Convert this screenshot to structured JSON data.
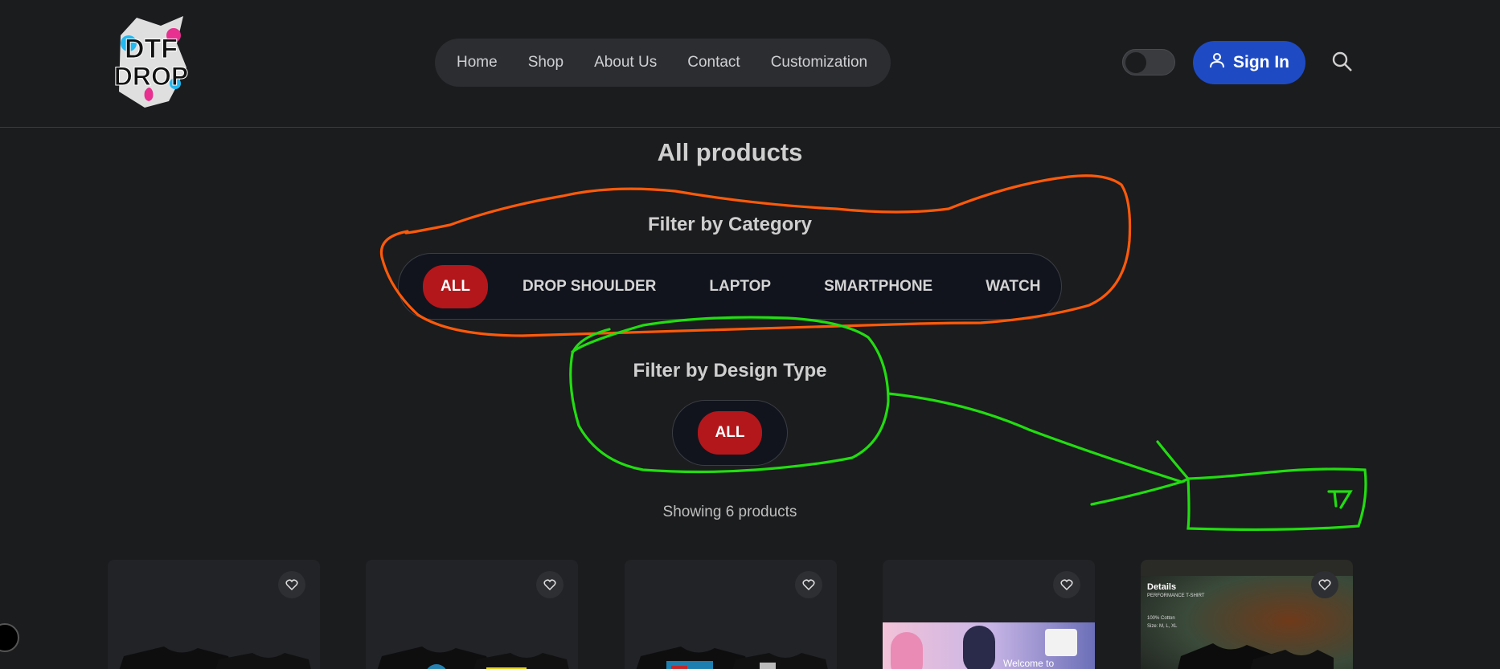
{
  "brand": {
    "logo_line1": "DTF",
    "logo_line2": "DROP"
  },
  "nav": {
    "items": [
      "Home",
      "Shop",
      "About Us",
      "Contact",
      "Customization"
    ]
  },
  "header": {
    "signin_label": "Sign In"
  },
  "main": {
    "title": "All products",
    "category_filter": {
      "heading": "Filter by Category",
      "options": [
        "ALL",
        "DROP SHOULDER",
        "LAPTOP",
        "SMARTPHONE",
        "WATCH"
      ],
      "selected": "ALL"
    },
    "design_filter": {
      "heading": "Filter by Design Type",
      "options": [
        "ALL"
      ],
      "selected": "ALL"
    },
    "showing_text": "Showing 6 products"
  },
  "cards": [
    {
      "name": "plain-black-tee"
    },
    {
      "name": "anime-print-tee"
    },
    {
      "name": "gta-print-tee"
    },
    {
      "name": "welcome-banner-card",
      "banner_text": "Welcome to"
    },
    {
      "name": "performance-tee",
      "details_title": "Details",
      "details_sub": "PERFORMANCE T-SHIRT",
      "material": "100% Cotton",
      "size": "Size: M, L, XL"
    }
  ],
  "colors": {
    "accent": "#1e4bc4",
    "active_pill": "#b3171b",
    "annot_orange": "#ff5a0a",
    "annot_green": "#22dd11"
  }
}
